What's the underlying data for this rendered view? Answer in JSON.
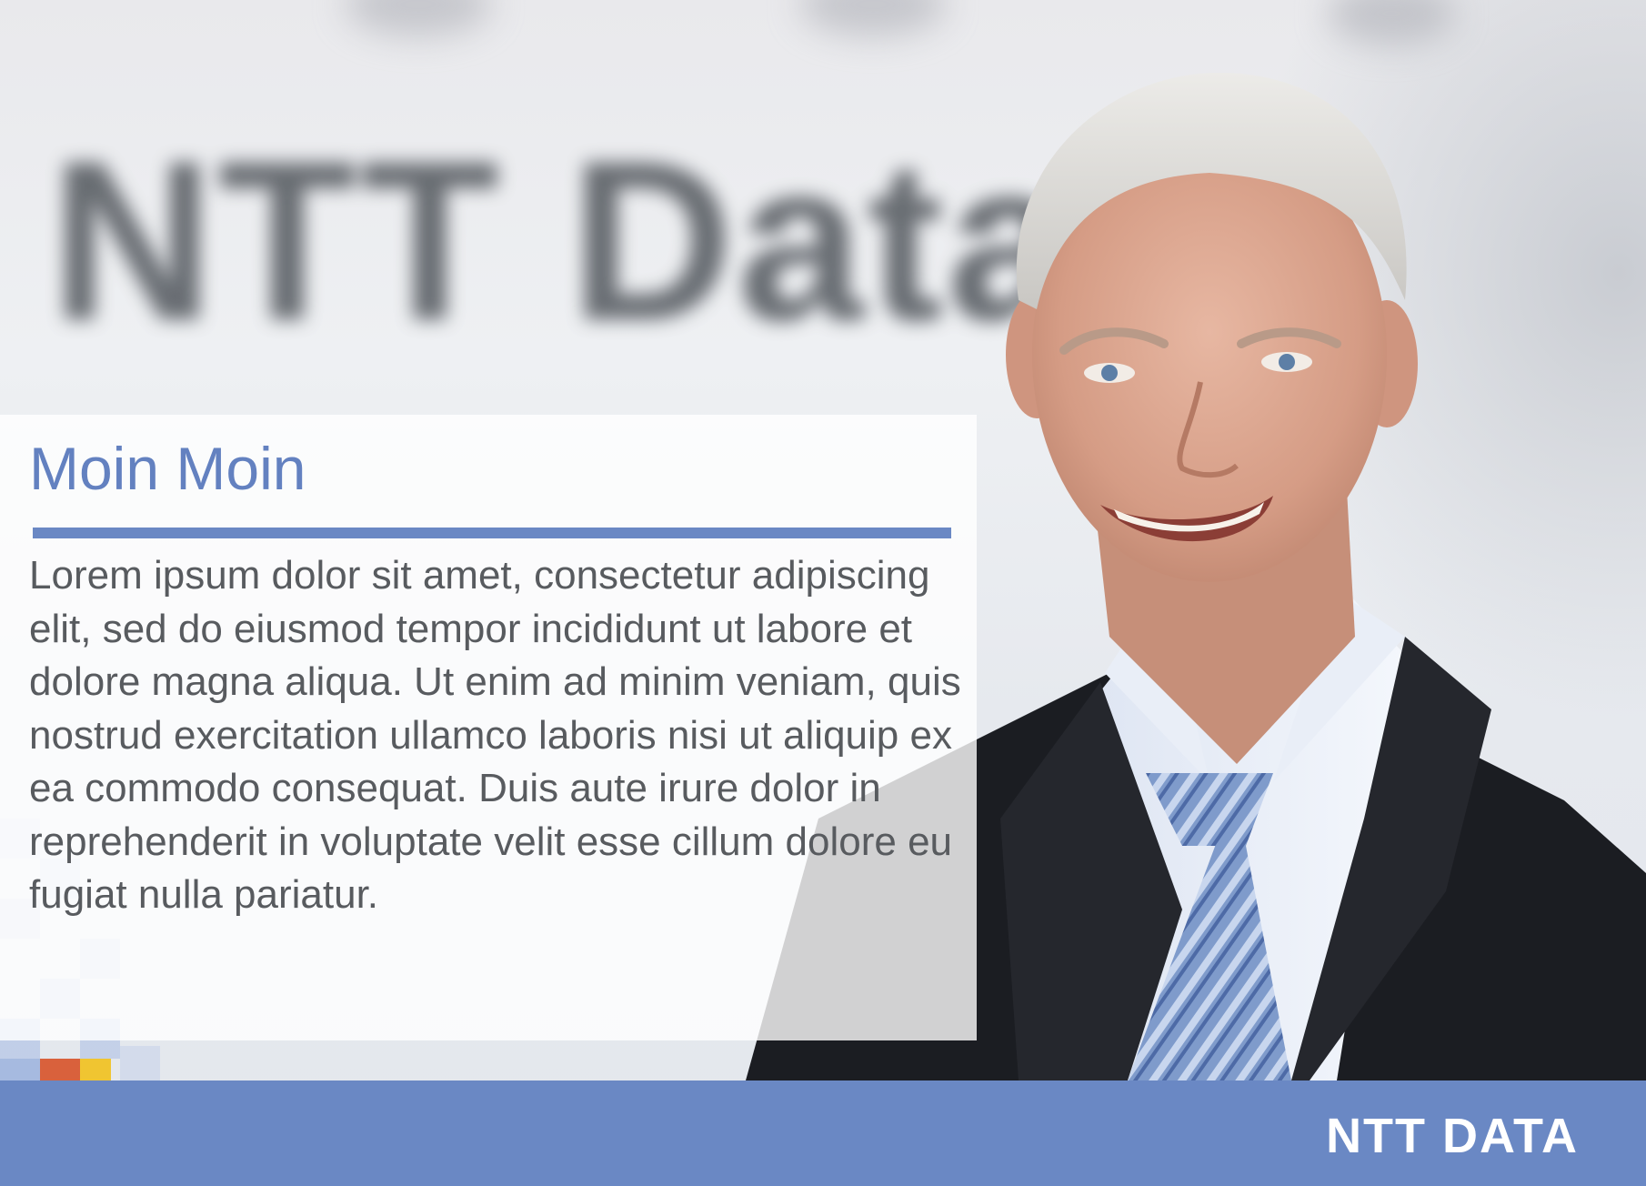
{
  "panel": {
    "headline": "Moin Moin",
    "body": "Lorem ipsum dolor sit amet, consectetur adipiscing elit, sed do eiusmod tempor incididunt ut labore et dolore magna aliqua. Ut enim ad minim veniam, quis nostrud exercitation ullamco laboris nisi ut aliquip ex ea commodo consequat. Duis aute irure dolor in reprehenderit in voluptate velit esse cillum dolore eu fugiat nulla pariatur."
  },
  "background": {
    "sign_text": "NTT Data"
  },
  "footer": {
    "logo_text": "NTT DATA"
  },
  "colors": {
    "accent_blue": "#6a88c4",
    "headline_blue": "#6381c0",
    "body_gray": "#585b5f",
    "mosaic_orange": "#d9613c",
    "mosaic_yellow": "#f0c531",
    "mosaic_teal": "#1d7f8f"
  }
}
